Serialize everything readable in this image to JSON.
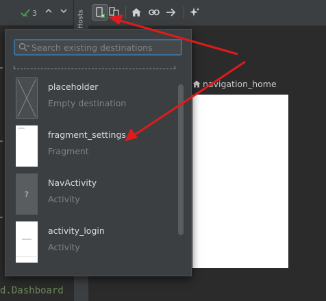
{
  "editor": {
    "warning_count": "3",
    "code_snippet": "d.Dashboard"
  },
  "side_panel": {
    "hosts_label": "Hosts"
  },
  "toolbar": {
    "buttons": [
      "new-destination-icon",
      "nested-graph-icon",
      "home-icon",
      "deep-link-icon",
      "action-arrow-icon",
      "auto-arrange-icon"
    ]
  },
  "canvas": {
    "home_destination_label": "navigation_home"
  },
  "popup": {
    "search_placeholder": "Search existing destinations",
    "search_value": "",
    "destinations": [
      {
        "name": "placeholder",
        "type": "Empty destination"
      },
      {
        "name": "fragment_settings",
        "type": "Fragment"
      },
      {
        "name": "NavActivity",
        "type": "Activity",
        "badge": "?"
      },
      {
        "name": "activity_login",
        "type": "Activity"
      }
    ]
  },
  "annotation_color": "#e01b1b"
}
